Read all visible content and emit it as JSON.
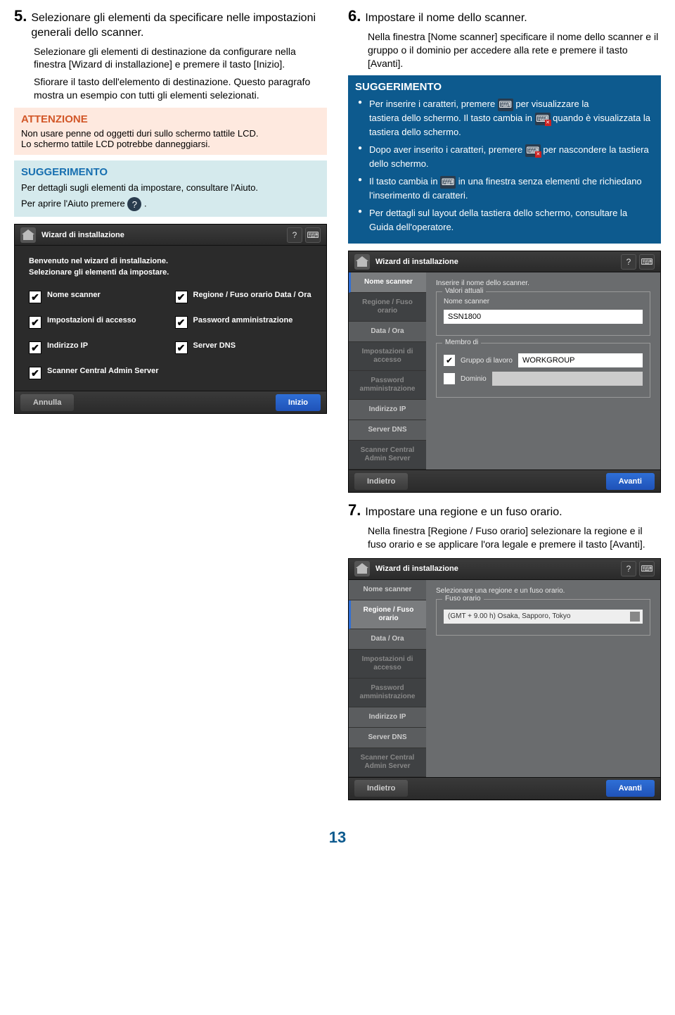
{
  "left": {
    "step5_num": "5.",
    "step5_head": "Selezionare gli elementi da specificare nelle impostazioni generali dello scanner.",
    "step5_p1": "Selezionare gli elementi di destinazione da configurare nella finestra [Wizard di installazione] e premere il tasto [Inizio].",
    "step5_p2": "Sfiorare il tasto dell'elemento di destinazione. Questo paragrafo mostra un esempio con tutti gli elementi selezionati.",
    "attention_title": "ATTENZIONE",
    "attention_l1": "Non usare penne od oggetti duri sullo schermo tattile LCD.",
    "attention_l2": "Lo schermo tattile LCD potrebbe danneggiarsi.",
    "hint_title": "SUGGERIMENTO",
    "hint_l1": "Per dettagli sugli elementi da impostare, consultare l'Aiuto.",
    "hint_l2a": "Per aprire l'Aiuto premere ",
    "hint_l2b": "."
  },
  "right": {
    "step6_num": "6.",
    "step6_head": "Impostare il nome dello scanner.",
    "step6_p1": "Nella finestra [Nome scanner] specificare il nome dello scanner e il gruppo o il dominio per accedere alla rete e premere il tasto [Avanti].",
    "hint_title": "SUGGERIMENTO",
    "b1a": "Per inserire i caratteri, premere ",
    "b1b": " per visualizzare la",
    "b2a": "tastiera dello schermo. Il tasto cambia in ",
    "b2b": " quando è visualizzata la tastiera dello schermo.",
    "b3a": "Dopo aver inserito i caratteri, premere ",
    "b3b": " per nascondere la tastiera dello schermo.",
    "b4a": "Il tasto cambia in ",
    "b4b": " in una finestra senza elementi che richiedano l'inserimento di caratteri.",
    "b5": "Per dettagli sul layout della tastiera dello schermo, consultare la Guida dell'operatore.",
    "step7_num": "7.",
    "step7_head": "Impostare una regione e un fuso orario.",
    "step7_p1": "Nella finestra [Regione / Fuso orario] selezionare la regione e il fuso orario e se applicare l'ora legale e premere il tasto [Avanti]."
  },
  "ss1": {
    "title": "Wizard di installazione",
    "intro1": "Benvenuto nel wizard di installazione.",
    "intro2": "Selezionare gli elementi da impostare.",
    "c1": "Nome scanner",
    "c2": "Regione / Fuso orario Data / Ora",
    "c3": "Impostazioni di accesso",
    "c4": "Password amministrazione",
    "c5": "Indirizzo IP",
    "c6": "Server DNS",
    "c7": "Scanner Central Admin Server",
    "cancel": "Annulla",
    "start": "Inizio"
  },
  "ss2": {
    "title": "Wizard di installazione",
    "side1": "Nome scanner",
    "side2": "Regione / Fuso orario",
    "side3": "Data / Ora",
    "side4": "Impostazioni di accesso",
    "side5": "Password amministrazione",
    "side6": "Indirizzo IP",
    "side7": "Server DNS",
    "side8": "Scanner Central Admin Server",
    "prompt": "Inserire il nome dello scanner.",
    "legend1": "Valori attuali",
    "lbl_name": "Nome scanner",
    "val_name": "SSN1800",
    "legend2": "Membro di",
    "lbl_group": "Gruppo di lavoro",
    "val_group": "WORKGROUP",
    "lbl_domain": "Dominio",
    "back": "Indietro",
    "next": "Avanti"
  },
  "ss3": {
    "title": "Wizard di installazione",
    "side1": "Nome scanner",
    "side2": "Regione / Fuso orario",
    "side3": "Data / Ora",
    "side4": "Impostazioni di accesso",
    "side5": "Password amministrazione",
    "side6": "Indirizzo IP",
    "side7": "Server DNS",
    "side8": "Scanner Central Admin Server",
    "prompt": "Selezionare una regione e un fuso orario.",
    "legend": "Fuso orario",
    "tz": "(GMT + 9.00 h) Osaka, Sapporo, Tokyo",
    "back": "Indietro",
    "next": "Avanti"
  },
  "page": "13"
}
